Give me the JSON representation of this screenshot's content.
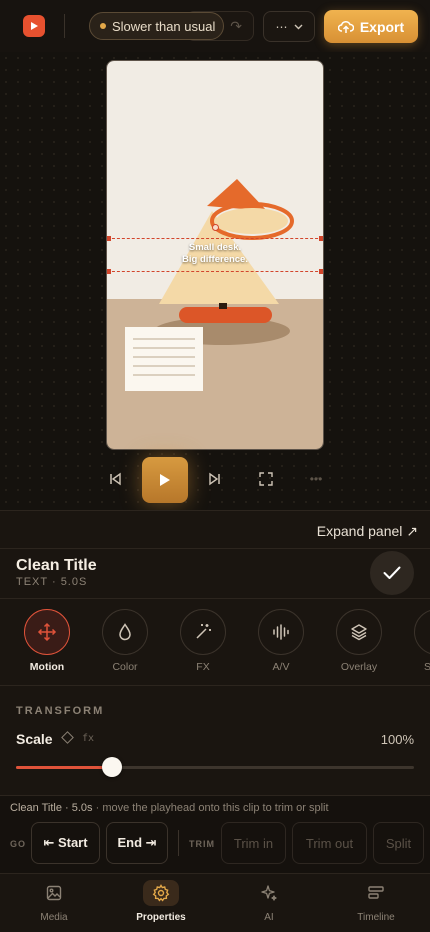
{
  "header": {
    "status_text": "Slower than usual",
    "more_label": "⋯",
    "export_label": "Export"
  },
  "canvas": {
    "overlay_line1": "Small desk.",
    "overlay_line2": "Big difference."
  },
  "panel": {
    "expand_label": "Expand panel ↗"
  },
  "clip": {
    "title": "Clean Title",
    "meta": "TEXT · 5.0S"
  },
  "tools": [
    {
      "label": "Motion",
      "icon": "move-icon"
    },
    {
      "label": "Color",
      "icon": "droplet-icon"
    },
    {
      "label": "FX",
      "icon": "magic-wand-icon"
    },
    {
      "label": "A/V",
      "icon": "waveform-icon"
    },
    {
      "label": "Overlay",
      "icon": "layers-icon"
    },
    {
      "label": "S",
      "icon": "partial-icon"
    }
  ],
  "transform": {
    "section_title": "TRANSFORM",
    "scale_label": "Scale",
    "fx_label": "fx",
    "scale_value": "100%",
    "slider_fraction": 0.24
  },
  "trim": {
    "hint_clip": "Clean Title · 5.0s",
    "hint_text": " · move the playhead onto this clip to trim or split",
    "go_label": "GO",
    "start_label": "⇤ Start",
    "end_label": "End ⇥",
    "trim_label": "TRIM",
    "trim_in_label": "Trim in",
    "trim_out_label": "Trim out",
    "split_label": "Split"
  },
  "nav": {
    "media": "Media",
    "properties": "Properties",
    "ai": "AI",
    "timeline": "Timeline"
  },
  "colors": {
    "accent": "#e0533a",
    "export": "#e8a443",
    "background": "#17130f"
  }
}
